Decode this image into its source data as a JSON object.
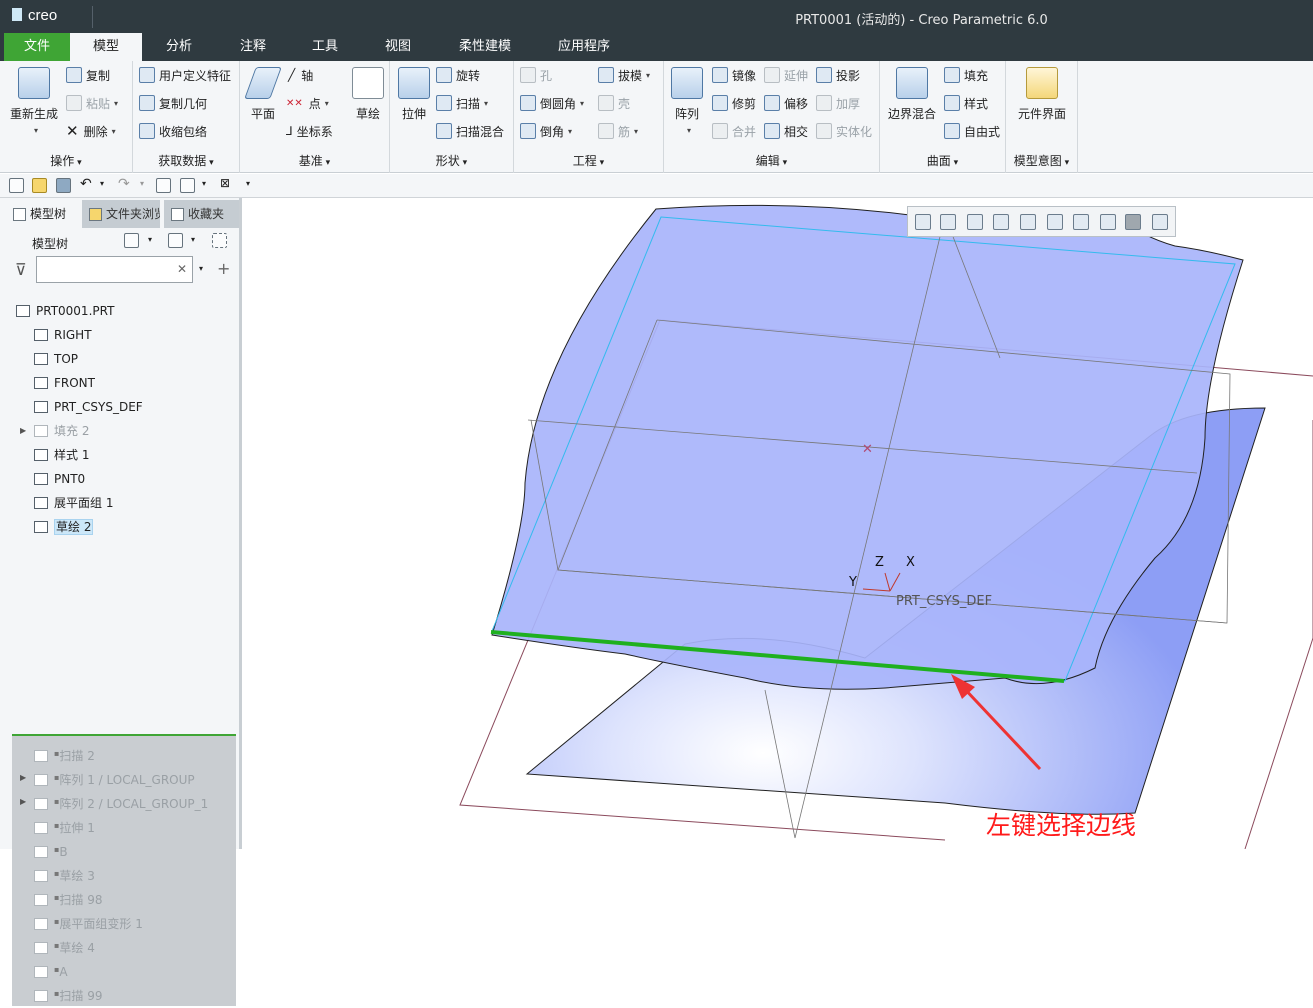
{
  "window": {
    "app_logo": "creo",
    "title": "PRT0001 (活动的) - Creo Parametric 6.0"
  },
  "tabs": [
    "文件",
    "模型",
    "分析",
    "注释",
    "工具",
    "视图",
    "柔性建模",
    "应用程序"
  ],
  "ribbon": {
    "operations": {
      "label": "操作",
      "regenerate": "重新生成",
      "copy": "复制",
      "paste": "粘贴",
      "delete": "删除"
    },
    "get_data": {
      "label": "获取数据",
      "udf": "用户定义特征",
      "copy_geom": "复制几何",
      "shrinkwrap": "收缩包络"
    },
    "datum": {
      "label": "基准",
      "plane": "平面",
      "axis": "轴",
      "point": "点",
      "csys": "坐标系",
      "sketch": "草绘"
    },
    "shapes": {
      "label": "形状",
      "extrude": "拉伸",
      "revolve": "旋转",
      "sweep": "扫描",
      "swept_blend": "扫描混合"
    },
    "engineering": {
      "label": "工程",
      "hole": "孔",
      "round": "倒圆角",
      "chamfer": "倒角",
      "draft": "拔模",
      "shell": "壳",
      "rib": "筋"
    },
    "editing": {
      "label": "编辑",
      "pattern": "阵列",
      "mirror": "镜像",
      "trim": "修剪",
      "merge": "合并",
      "extend": "延伸",
      "offset": "偏移",
      "intersect": "相交",
      "project": "投影",
      "thicken": "加厚",
      "solidify": "实体化"
    },
    "surfaces": {
      "label": "曲面",
      "boundary_blend": "边界混合",
      "fill": "填充",
      "style": "样式",
      "freestyle": "自由式"
    },
    "model_intent": {
      "label": "模型意图",
      "component_interface": "元件界面"
    }
  },
  "panel_tabs": [
    "模型树",
    "文件夹浏览器",
    "收藏夹"
  ],
  "tree_header": "模型树",
  "filter": {
    "value": ""
  },
  "tree": [
    {
      "label": "PRT0001.PRT",
      "icon": "part-icon",
      "state": "normal"
    },
    {
      "label": "RIGHT",
      "icon": "datum-plane-icon",
      "state": "normal"
    },
    {
      "label": "TOP",
      "icon": "datum-plane-icon",
      "state": "normal"
    },
    {
      "label": "FRONT",
      "icon": "datum-plane-icon",
      "state": "normal"
    },
    {
      "label": "PRT_CSYS_DEF",
      "icon": "csys-icon",
      "state": "normal"
    },
    {
      "label": "填充 2",
      "icon": "fill-icon",
      "state": "dim"
    },
    {
      "label": "样式 1",
      "icon": "style-icon",
      "state": "normal"
    },
    {
      "label": "PNT0",
      "icon": "point-icon",
      "state": "normal"
    },
    {
      "label": "展平面组 1",
      "icon": "flatten-icon",
      "state": "normal"
    },
    {
      "label": "草绘 2",
      "icon": "sketch-icon",
      "state": "selected"
    }
  ],
  "suppressed": [
    {
      "label": "扫描 2",
      "icon": "sweep-icon"
    },
    {
      "label": "阵列 1 / LOCAL_GROUP",
      "icon": "pattern-icon"
    },
    {
      "label": "阵列 2 / LOCAL_GROUP_1",
      "icon": "pattern-icon"
    },
    {
      "label": "拉伸 1",
      "icon": "extrude-icon"
    },
    {
      "label": "B",
      "icon": "csys-icon"
    },
    {
      "label": "草绘 3",
      "icon": "sketch-icon"
    },
    {
      "label": "扫描 98",
      "icon": "sweep-icon"
    },
    {
      "label": "展平面组变形 1",
      "icon": "flatten-deform-icon"
    },
    {
      "label": "草绘 4",
      "icon": "sketch-icon"
    },
    {
      "label": "A",
      "icon": "csys-icon"
    },
    {
      "label": "扫描 99",
      "icon": "sweep-icon"
    }
  ],
  "viewport": {
    "csys_label": "PRT_CSYS_DEF",
    "axis_x": "X",
    "axis_y": "Y",
    "axis_z": "Z",
    "annotation": "左键选择边线",
    "colors": {
      "surface": "#9eaefc",
      "edge_selected": "#1fb01f",
      "arrow": "#ee3333",
      "annotation": "#ff1a1a"
    }
  }
}
